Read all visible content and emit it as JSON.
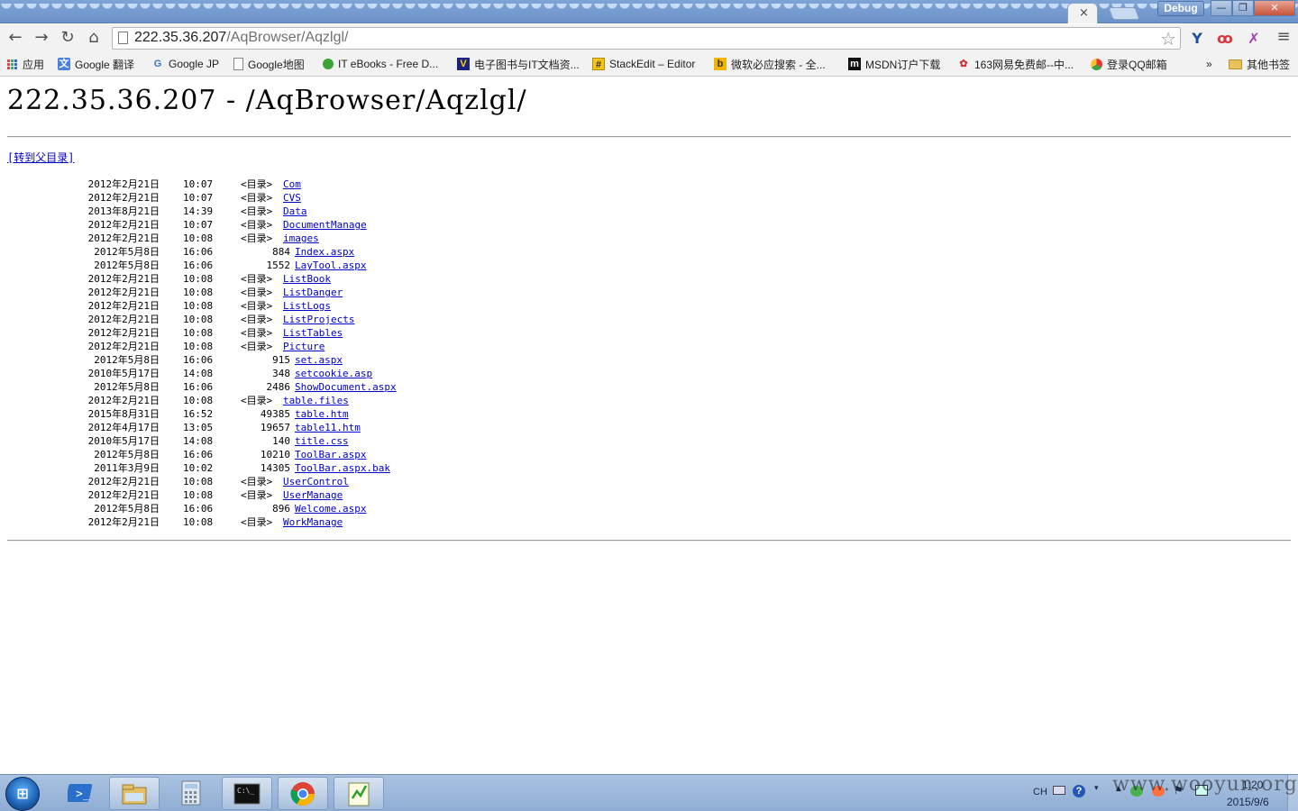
{
  "window": {
    "tab_close": "×",
    "debug_label": "Debug",
    "minimize": "—",
    "restore": "❐",
    "close": "✕"
  },
  "toolbar": {
    "back": "←",
    "forward": "→",
    "reload": "↻",
    "home": "⌂",
    "url_host": "222.35.36.207",
    "url_path": "/AqBrowser/Aqzlgl/",
    "star": "☆",
    "ext1": "Y",
    "ext2": "ꝏ",
    "ext3": "✗",
    "menu": "≡"
  },
  "bookmarks": {
    "apps": "应用",
    "items": [
      "Google 翻译",
      "Google JP",
      "Google地图",
      "IT eBooks - Free D...",
      "电子图书与IT文档资...",
      "StackEdit – Editor",
      "微软必应搜索 - 全...",
      "MSDN订户下载",
      "163网易免费邮--中...",
      "登录QQ邮箱"
    ],
    "overflow": "»",
    "other": "其他书签"
  },
  "page": {
    "title": "222.35.36.207 - /AqBrowser/Aqzlgl/",
    "parent_link": "[转到父目录]",
    "dir_tag": "<目录>",
    "entries": [
      {
        "date": "2012年2月21日",
        "time": "10:07",
        "size": "",
        "name": "Com",
        "dir": true
      },
      {
        "date": "2012年2月21日",
        "time": "10:07",
        "size": "",
        "name": "CVS",
        "dir": true
      },
      {
        "date": "2013年8月21日",
        "time": "14:39",
        "size": "",
        "name": "Data",
        "dir": true
      },
      {
        "date": "2012年2月21日",
        "time": "10:07",
        "size": "",
        "name": "DocumentManage",
        "dir": true
      },
      {
        "date": "2012年2月21日",
        "time": "10:08",
        "size": "",
        "name": "images",
        "dir": true
      },
      {
        "date": "2012年5月8日",
        "time": "16:06",
        "size": "884",
        "name": "Index.aspx",
        "dir": false
      },
      {
        "date": "2012年5月8日",
        "time": "16:06",
        "size": "1552",
        "name": "LayTool.aspx",
        "dir": false
      },
      {
        "date": "2012年2月21日",
        "time": "10:08",
        "size": "",
        "name": "ListBook",
        "dir": true
      },
      {
        "date": "2012年2月21日",
        "time": "10:08",
        "size": "",
        "name": "ListDanger",
        "dir": true
      },
      {
        "date": "2012年2月21日",
        "time": "10:08",
        "size": "",
        "name": "ListLogs",
        "dir": true
      },
      {
        "date": "2012年2月21日",
        "time": "10:08",
        "size": "",
        "name": "ListProjects",
        "dir": true
      },
      {
        "date": "2012年2月21日",
        "time": "10:08",
        "size": "",
        "name": "ListTables",
        "dir": true
      },
      {
        "date": "2012年2月21日",
        "time": "10:08",
        "size": "",
        "name": "Picture",
        "dir": true
      },
      {
        "date": "2012年5月8日",
        "time": "16:06",
        "size": "915",
        "name": "set.aspx",
        "dir": false
      },
      {
        "date": "2010年5月17日",
        "time": "14:08",
        "size": "348",
        "name": "setcookie.asp",
        "dir": false
      },
      {
        "date": "2012年5月8日",
        "time": "16:06",
        "size": "2486",
        "name": "ShowDocument.aspx",
        "dir": false
      },
      {
        "date": "2012年2月21日",
        "time": "10:08",
        "size": "",
        "name": "table.files",
        "dir": true
      },
      {
        "date": "2015年8月31日",
        "time": "16:52",
        "size": "49385",
        "name": "table.htm",
        "dir": false
      },
      {
        "date": "2012年4月17日",
        "time": "13:05",
        "size": "19657",
        "name": "table11.htm",
        "dir": false
      },
      {
        "date": "2010年5月17日",
        "time": "14:08",
        "size": "140",
        "name": "title.css",
        "dir": false
      },
      {
        "date": "2012年5月8日",
        "time": "16:06",
        "size": "10210",
        "name": "ToolBar.aspx",
        "dir": false
      },
      {
        "date": "2011年3月9日",
        "time": "10:02",
        "size": "14305",
        "name": "ToolBar.aspx.bak",
        "dir": false
      },
      {
        "date": "2012年2月21日",
        "time": "10:08",
        "size": "",
        "name": "UserControl",
        "dir": true
      },
      {
        "date": "2012年2月21日",
        "time": "10:08",
        "size": "",
        "name": "UserManage",
        "dir": true
      },
      {
        "date": "2012年5月8日",
        "time": "16:06",
        "size": "896",
        "name": "Welcome.aspx",
        "dir": false
      },
      {
        "date": "2012年2月21日",
        "time": "10:08",
        "size": "",
        "name": "WorkManage",
        "dir": true
      }
    ]
  },
  "taskbar": {
    "start": "⊞",
    "lang": "CH",
    "clock_time": "1:20",
    "clock_date": "2015/9/6",
    "watermark": "www.wooyun.org"
  },
  "colors": {
    "link": "#0000cc",
    "titlebar": "#7ea4d6",
    "taskbar": "#9db8dc"
  }
}
